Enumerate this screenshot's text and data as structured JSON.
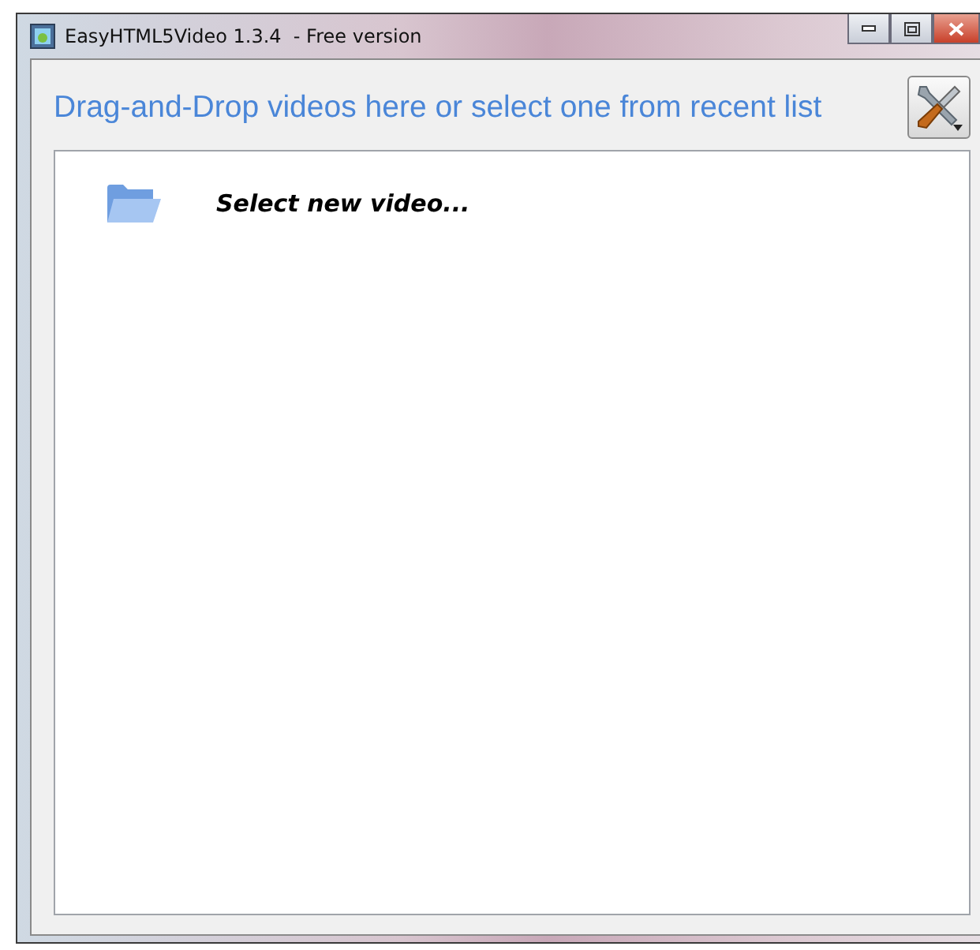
{
  "window": {
    "title": "EasyHTML5Video 1.3.4  - Free version"
  },
  "heading": "Drag-and-Drop videos here or select one from recent list",
  "video_list": {
    "items": [
      {
        "label": "Select new video..."
      }
    ]
  }
}
